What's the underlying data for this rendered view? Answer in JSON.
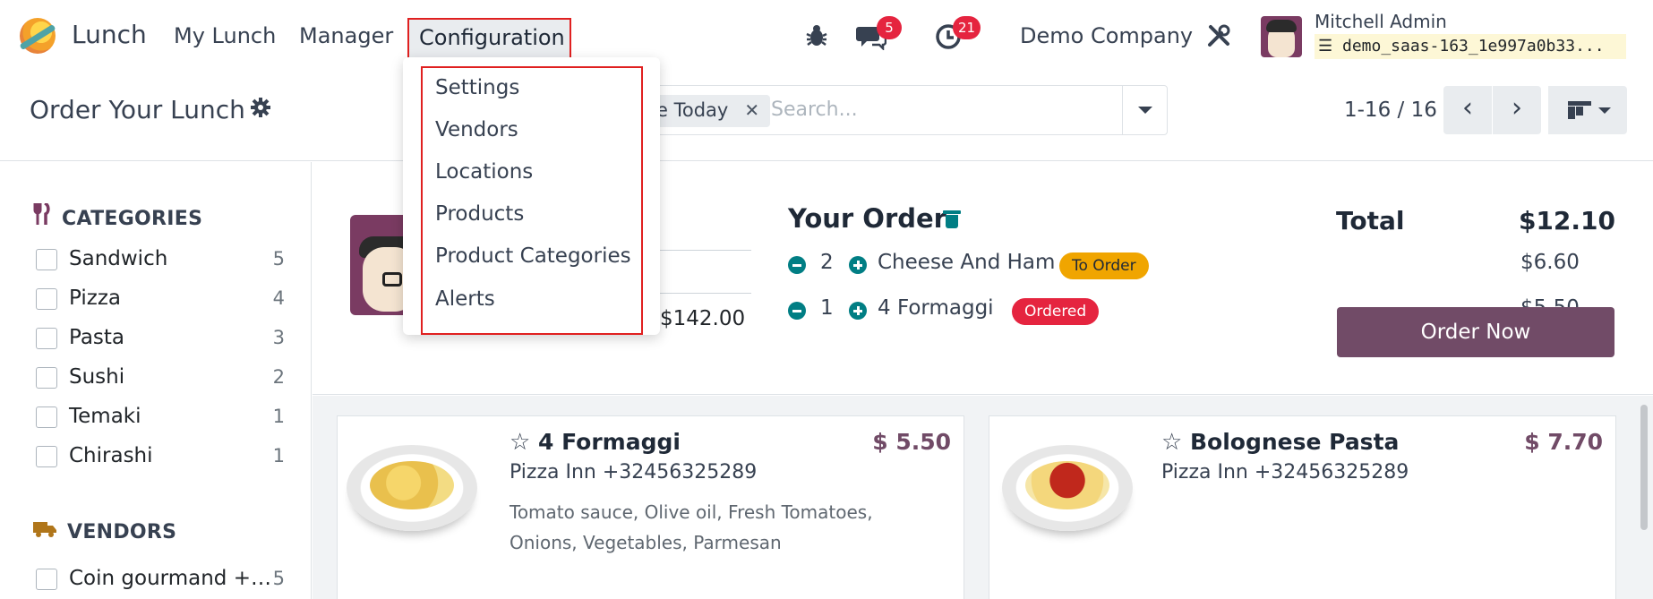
{
  "app": {
    "name": "Lunch"
  },
  "nav": {
    "items": [
      {
        "label": "My Lunch"
      },
      {
        "label": "Manager"
      },
      {
        "label": "Configuration"
      }
    ],
    "messages_badge": "5",
    "activities_badge": "21",
    "company": "Demo Company",
    "user_name": "Mitchell Admin",
    "database": "demo_saas-163_1e997a0b33..."
  },
  "config_menu": {
    "items": [
      "Settings",
      "Vendors",
      "Locations",
      "Products",
      "Product Categories",
      "Alerts"
    ]
  },
  "control": {
    "title": "Order Your Lunch",
    "facet": "e Today",
    "search_placeholder": "Search...",
    "pager": "1-16 / 16"
  },
  "sidebar": {
    "categories_title": "CATEGORIES",
    "categories": [
      {
        "label": "Sandwich",
        "count": "5"
      },
      {
        "label": "Pizza",
        "count": "4"
      },
      {
        "label": "Pasta",
        "count": "3"
      },
      {
        "label": "Sushi",
        "count": "2"
      },
      {
        "label": "Temaki",
        "count": "1"
      },
      {
        "label": "Chirashi",
        "count": "1"
      }
    ],
    "vendors_title": "VENDORS",
    "vendors": [
      {
        "label": "Coin gourmand +…",
        "count": "5"
      }
    ]
  },
  "summary": {
    "account_amount": "$142.00",
    "your_order_title": "Your Order",
    "lines": [
      {
        "qty": "2",
        "product": "Cheese And Ham",
        "state": "To Order",
        "price": "$6.60"
      },
      {
        "qty": "1",
        "product": "4 Formaggi",
        "state": "Ordered",
        "price": "$5.50"
      }
    ],
    "total_label": "Total",
    "total_value": "$12.10",
    "order_button": "Order Now"
  },
  "products": [
    {
      "name": "4 Formaggi",
      "price": "$ 5.50",
      "vendor": "Pizza Inn +32456325289",
      "description": "Tomato sauce, Olive oil, Fresh Tomatoes, Onions, Vegetables, Parmesan"
    },
    {
      "name": "Bolognese Pasta",
      "price": "$ 7.70",
      "vendor": "Pizza Inn +32456325289",
      "description": ""
    }
  ],
  "colors": {
    "brand": "#714b67",
    "teal": "#017e84",
    "badge_red": "#e5243f",
    "to_order": "#f0a500",
    "highlight": "#e02020"
  },
  "icons": [
    "app-logo-icon",
    "bug-icon",
    "chat-icon",
    "clock-icon",
    "tools-icon",
    "gear-icon",
    "chevron-left-icon",
    "chevron-right-icon",
    "kanban-view-icon",
    "cutlery-icon",
    "truck-icon",
    "trash-icon",
    "minus-circle-icon",
    "plus-circle-icon",
    "star-icon"
  ]
}
